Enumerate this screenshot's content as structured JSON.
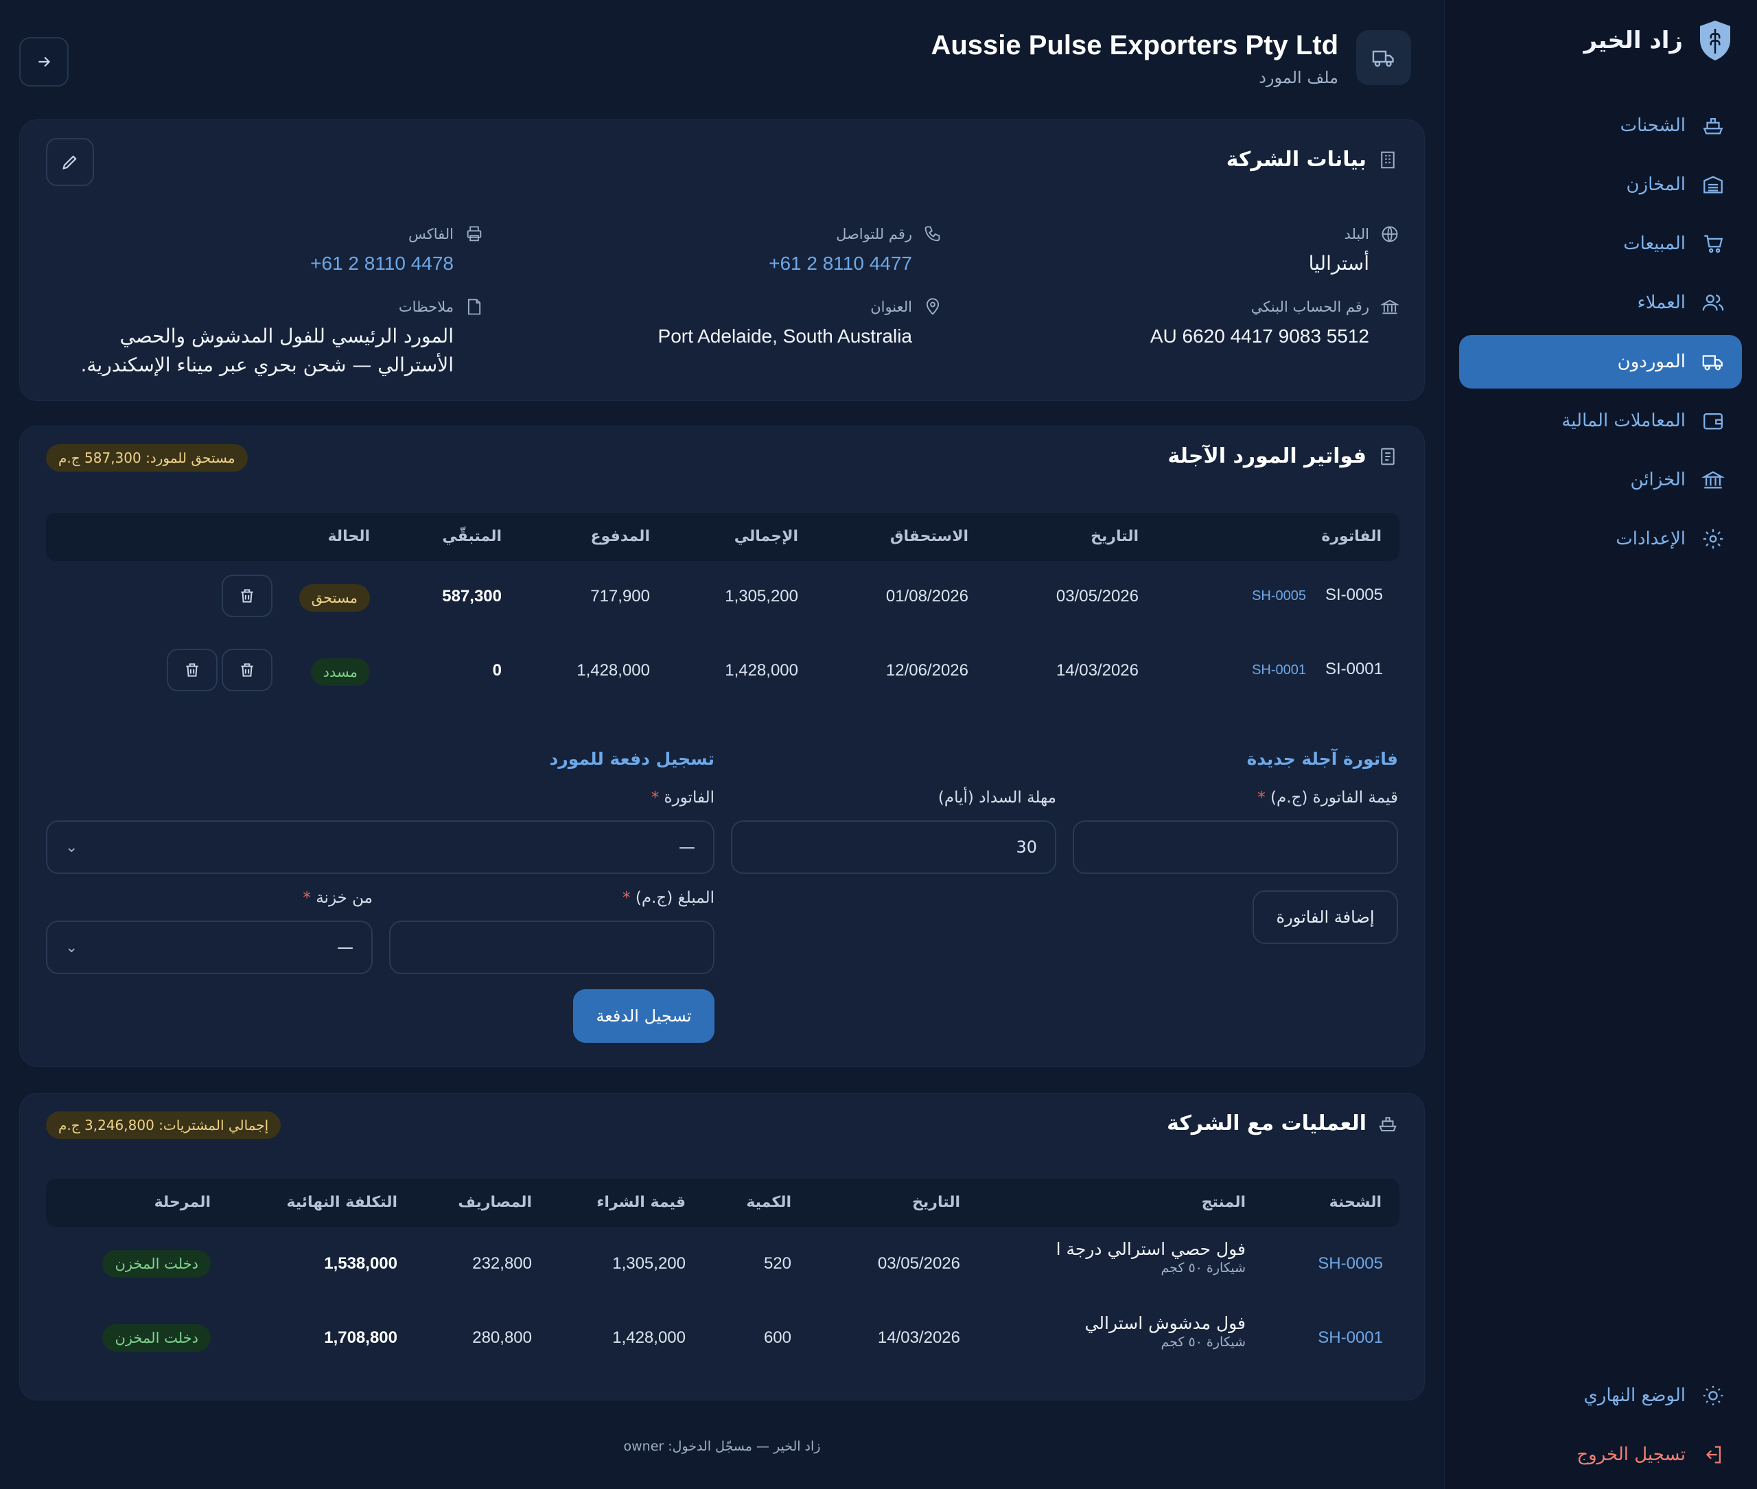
{
  "brand": {
    "name": "زاد الخير"
  },
  "nav": [
    {
      "label": "الشحنات",
      "icon": "ship-icon",
      "active": false
    },
    {
      "label": "المخازن",
      "icon": "warehouse-icon",
      "active": false
    },
    {
      "label": "المبيعات",
      "icon": "cart-icon",
      "active": false
    },
    {
      "label": "العملاء",
      "icon": "users-icon",
      "active": false
    },
    {
      "label": "الموردون",
      "icon": "truck-icon",
      "active": true
    },
    {
      "label": "المعاملات المالية",
      "icon": "wallet-icon",
      "active": false
    },
    {
      "label": "الخزائن",
      "icon": "bank-icon",
      "active": false
    },
    {
      "label": "الإعدادات",
      "icon": "gear-icon",
      "active": false
    }
  ],
  "sidebar_bottom": {
    "theme_label": "الوضع النهاري",
    "logout_label": "تسجيل الخروج"
  },
  "header": {
    "title": "Aussie Pulse Exporters Pty Ltd",
    "subtitle": "ملف المورد"
  },
  "company": {
    "title": "بيانات الشركة",
    "country_label": "البلد",
    "country": "أستراليا",
    "phone_label": "رقم للتواصل",
    "phone": "+61 2 8110 4477",
    "fax_label": "الفاكس",
    "fax": "+61 2 8110 4478",
    "bank_label": "رقم الحساب البنكي",
    "bank": "AU 6620 4417 9083 5512",
    "address_label": "العنوان",
    "address": "Port Adelaide, South Australia",
    "notes_label": "ملاحظات",
    "notes_line1": "المورد الرئيسي للفول المدشوش والحصي",
    "notes_line2": "الأسترالي — شحن بحري عبر ميناء الإسكندرية."
  },
  "invoices": {
    "title": "فواتير المورد الآجلة",
    "due_badge": "مستحق للمورد: 587,300 ج.م",
    "headers": {
      "invoice": "الفاتورة",
      "date": "التاريخ",
      "due": "الاستحقاق",
      "total": "الإجمالي",
      "paid": "المدفوع",
      "remaining": "المتبقّي",
      "status": "الحالة"
    },
    "rows": [
      {
        "invoice": "SI-0005",
        "shipment": "SH-0005",
        "date": "03/05/2026",
        "due": "01/08/2026",
        "total": "1,305,200",
        "paid": "717,900",
        "remaining": "587,300",
        "status": "مستحق",
        "status_kind": "due"
      },
      {
        "invoice": "SI-0001",
        "shipment": "SH-0001",
        "date": "14/03/2026",
        "due": "12/06/2026",
        "total": "1,428,000",
        "paid": "1,428,000",
        "remaining": "0",
        "status": "مسدد",
        "status_kind": "paid"
      }
    ]
  },
  "new_invoice": {
    "title": "فاتورة آجلة جديدة",
    "amount_label": "قيمة الفاتورة (ج.م)",
    "term_label": "مهلة السداد (أيام)",
    "term_value": "30",
    "add_button": "إضافة الفاتورة"
  },
  "payment": {
    "title": "تسجيل دفعة للمورد",
    "invoice_label": "الفاتورة",
    "invoice_value": "—",
    "amount_label": "المبلغ (ج.م)",
    "treasury_label": "من خزنة",
    "treasury_value": "—",
    "submit_button": "تسجيل الدفعة"
  },
  "operations": {
    "title": "العمليات مع الشركة",
    "total_badge": "إجمالي المشتريات: 3,246,800 ج.م",
    "headers": {
      "shipment": "الشحنة",
      "product": "المنتج",
      "date": "التاريخ",
      "qty": "الكمية",
      "purchase": "قيمة الشراء",
      "expenses": "المصاريف",
      "final_cost": "التكلفة النهائية",
      "stage": "المرحلة"
    },
    "rows": [
      {
        "shipment": "SH-0005",
        "product": "فول حصي استرالي درجة ا",
        "package": "شيكارة ٥٠ كجم",
        "date": "03/05/2026",
        "qty": "520",
        "purchase": "1,305,200",
        "expenses": "232,800",
        "final_cost": "1,538,000",
        "stage": "دخلت المخزن"
      },
      {
        "shipment": "SH-0001",
        "product": "فول مدشوش استرالي",
        "package": "شيكارة ٥٠ كجم",
        "date": "14/03/2026",
        "qty": "600",
        "purchase": "1,428,000",
        "expenses": "280,800",
        "final_cost": "1,708,800",
        "stage": "دخلت المخزن"
      }
    ]
  },
  "footer": {
    "text": "زاد الخير — مسجّل الدخول: owner"
  },
  "colors": {
    "accent": "#2f6fb8",
    "link": "#6ea8e8",
    "due": "#f0d48a",
    "paid": "#7fd48f",
    "danger": "#e3655b"
  }
}
